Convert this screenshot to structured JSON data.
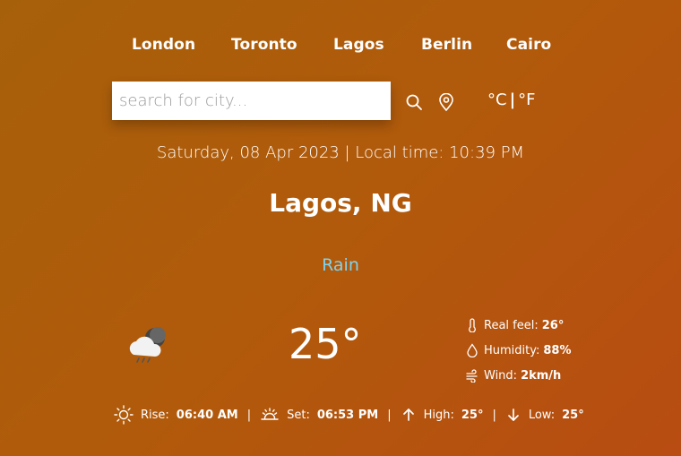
{
  "cities": [
    "London",
    "Toronto",
    "Lagos",
    "Berlin",
    "Cairo"
  ],
  "search": {
    "placeholder": "search for city..."
  },
  "units": {
    "celsius": "°C",
    "separator": "|",
    "fahrenheit": "°F"
  },
  "datetime": "Saturday, 08 Apr 2023 | Local time: 10:39 PM",
  "location": "Lagos, NG",
  "condition": "Rain",
  "temperature": "25°",
  "details": {
    "real_feel_label": "Real feel:",
    "real_feel_value": "26°",
    "humidity_label": "Humidity:",
    "humidity_value": "88%",
    "wind_label": "Wind:",
    "wind_value": "2km/h"
  },
  "bottom": {
    "rise_label": "Rise:",
    "rise_value": "06:40 AM",
    "set_label": "Set:",
    "set_value": "06:53 PM",
    "high_label": "High:",
    "high_value": "25°",
    "low_label": "Low:",
    "low_value": "25°",
    "separator": "|"
  },
  "icons": {
    "search": "search-icon",
    "location": "location-pin-icon",
    "weather": "night-rain-cloud-icon",
    "thermometer": "thermometer-icon",
    "humidity": "droplet-icon",
    "wind": "wind-icon",
    "sunrise": "sun-icon",
    "sunset": "sunset-icon",
    "high": "arrow-up-icon",
    "low": "arrow-down-icon"
  },
  "colors": {
    "condition": "#7fd3ee",
    "background_start": "#a7600a",
    "background_end": "#b84c12"
  }
}
